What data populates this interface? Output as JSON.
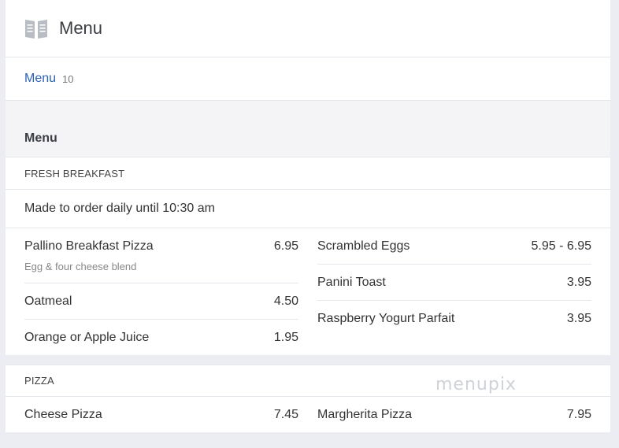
{
  "header": {
    "title": "Menu",
    "icon": "book-icon"
  },
  "tabs": [
    {
      "label": "Menu",
      "count": "10"
    }
  ],
  "menu": {
    "heading": "Menu"
  },
  "sections": [
    {
      "name": "FRESH BREAKFAST",
      "note": "Made to order daily until 10:30 am",
      "left": [
        {
          "name": "Pallino Breakfast Pizza",
          "price": "6.95",
          "desc": "Egg & four cheese blend"
        },
        {
          "name": "Oatmeal",
          "price": "4.50"
        },
        {
          "name": "Orange or Apple Juice",
          "price": "1.95"
        }
      ],
      "right": [
        {
          "name": "Scrambled Eggs",
          "price": "5.95 - 6.95"
        },
        {
          "name": "Panini Toast",
          "price": "3.95"
        },
        {
          "name": "Raspberry Yogurt Parfait",
          "price": "3.95"
        }
      ]
    },
    {
      "name": "PIZZA",
      "left": [
        {
          "name": "Cheese Pizza",
          "price": "7.45"
        }
      ],
      "right": [
        {
          "name": "Margherita Pizza",
          "price": "7.95"
        }
      ]
    }
  ],
  "watermark": "menupix"
}
